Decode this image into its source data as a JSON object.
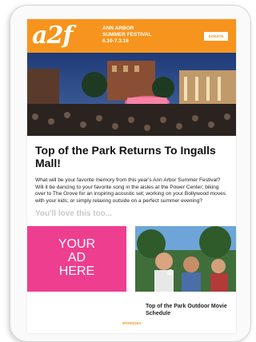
{
  "header": {
    "logo": "a2f",
    "line1": "ANN ARBOR",
    "line2": "SUMMER FESTIVAL",
    "dates": "6.10-7.3.16",
    "donate": "DONATE"
  },
  "article": {
    "headline": "Top of the Park Returns To Ingalls Mall!",
    "body": "What will be your favorite memory from this year's Ann Arbor Summer Festival? Will it be dancing to your favorite song in the aisles at the Power Center; biking over to The Grove for an inspiring acoustic set; working on your Bollywood moves with your kids; or simply relaxing outside on a perfect summer evening?"
  },
  "recommend": {
    "heading": "You'll love this too...",
    "ad_line1": "YOUR",
    "ad_line2": "AD",
    "ad_line3": "HERE",
    "movie_title": "Top of the Park Outdoor Movie Schedule"
  },
  "footer": {
    "sponsors": "SPONSORS"
  },
  "colors": {
    "brand_orange": "#f7941d",
    "ad_pink": "#ee3e8f"
  }
}
